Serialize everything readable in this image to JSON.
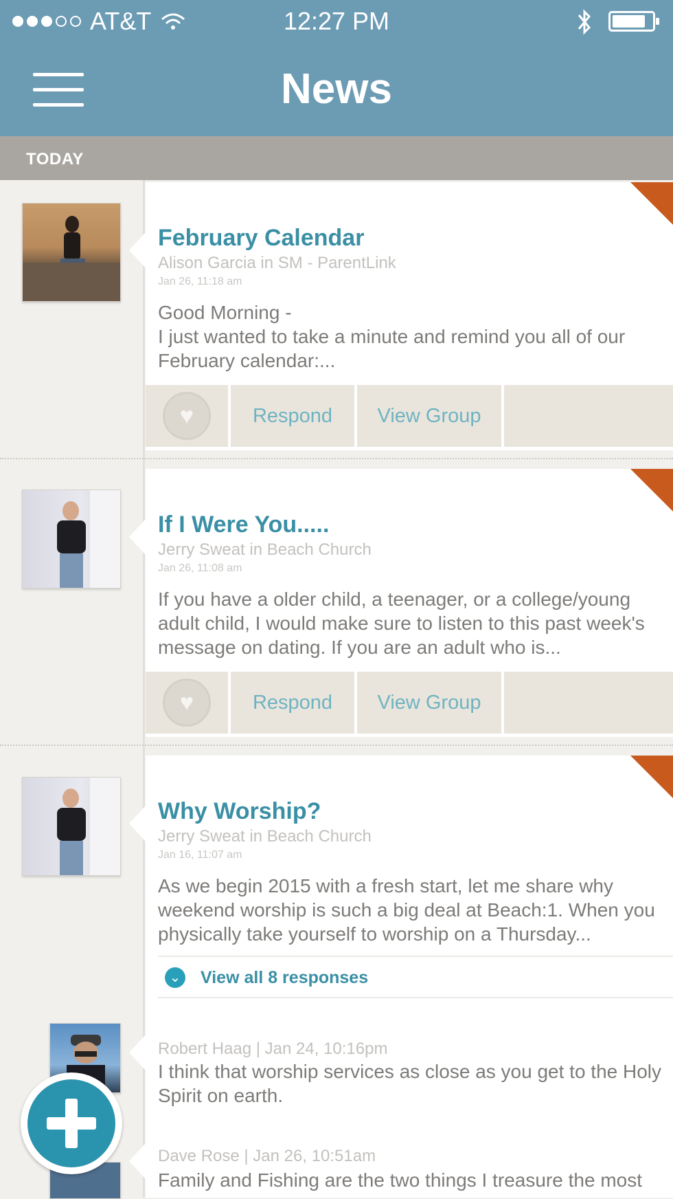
{
  "status_bar": {
    "carrier": "AT&T",
    "time": "12:27 PM",
    "signal_bars_filled": 3,
    "signal_bars_total": 5,
    "battery_level_percent": 80
  },
  "header": {
    "title": "News"
  },
  "section": {
    "label": "TODAY"
  },
  "posts": [
    {
      "title": "February Calendar",
      "author": "Alison Garcia in SM - ParentLink",
      "date": "Jan 26, 11:18 am",
      "body": "Good Morning -\nI just wanted to take a minute and remind you all of our February calendar:...",
      "actions": {
        "respond": "Respond",
        "view_group": "View Group"
      }
    },
    {
      "title": "If I Were You.....",
      "author": "Jerry Sweat in Beach Church",
      "date": "Jan 26, 11:08 am",
      "body": "If you have a older child, a teenager, or a college/young adult child, I would make sure to listen to this past week's message on dating.  If you are an adult who is...",
      "actions": {
        "respond": "Respond",
        "view_group": "View Group"
      }
    },
    {
      "title": "Why Worship?",
      "author": "Jerry Sweat in Beach Church",
      "date": "Jan 16, 11:07 am",
      "body": "As we begin 2015 with a fresh start, let me share why weekend worship is such a big deal at Beach:1.  When you physically take yourself to worship on a Thursday...",
      "responses_label": "View all 8 responses",
      "comments": [
        {
          "meta": "Robert Haag | Jan 24, 10:16pm",
          "body": "I think that worship services as close as you get to the Holy Spirit on earth."
        },
        {
          "meta": "Dave Rose | Jan 26, 10:51am",
          "body": "Family and Fishing are the two things I treasure the most"
        }
      ]
    }
  ],
  "colors": {
    "nav": "#6c9bb4",
    "accent": "#3a8fa5",
    "corner": "#c85a1e",
    "action_bar": "#e9e5dd"
  },
  "icons": {
    "menu": "hamburger-icon",
    "like": "heart-icon",
    "expand": "chevron-down-icon",
    "compose": "plus-icon"
  }
}
